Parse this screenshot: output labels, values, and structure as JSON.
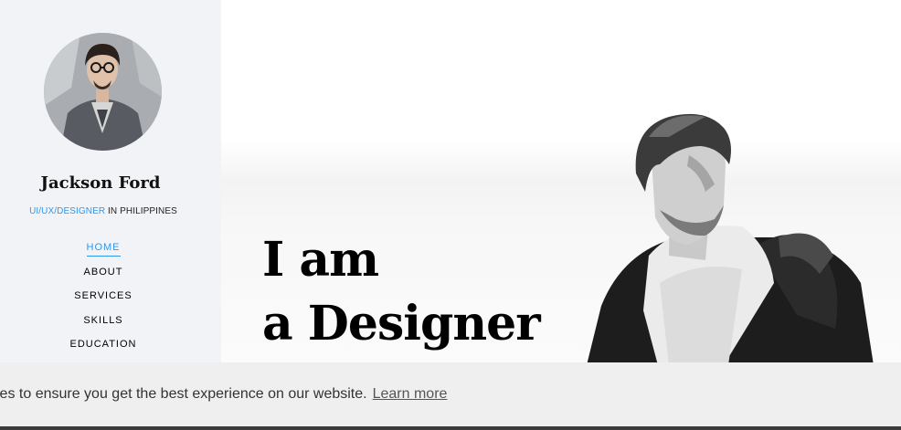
{
  "profile": {
    "name": "Jackson Ford",
    "role_highlight": "UI/UX/DESIGNER",
    "role_rest": " IN PHILIPPINES"
  },
  "nav": {
    "items": [
      {
        "label": "HOME",
        "active": true
      },
      {
        "label": "ABOUT"
      },
      {
        "label": "SERVICES"
      },
      {
        "label": "SKILLS"
      },
      {
        "label": "EDUCATION"
      }
    ]
  },
  "hero": {
    "line1": "I am",
    "line2": "a Designer"
  },
  "cookie": {
    "message": "kies to ensure you get the best experience on our website.",
    "link_label": "Learn more"
  },
  "colors": {
    "accent": "#2c98f0",
    "sidebar_bg": "#f2f3f7",
    "cookie_bg": "#efefef"
  }
}
